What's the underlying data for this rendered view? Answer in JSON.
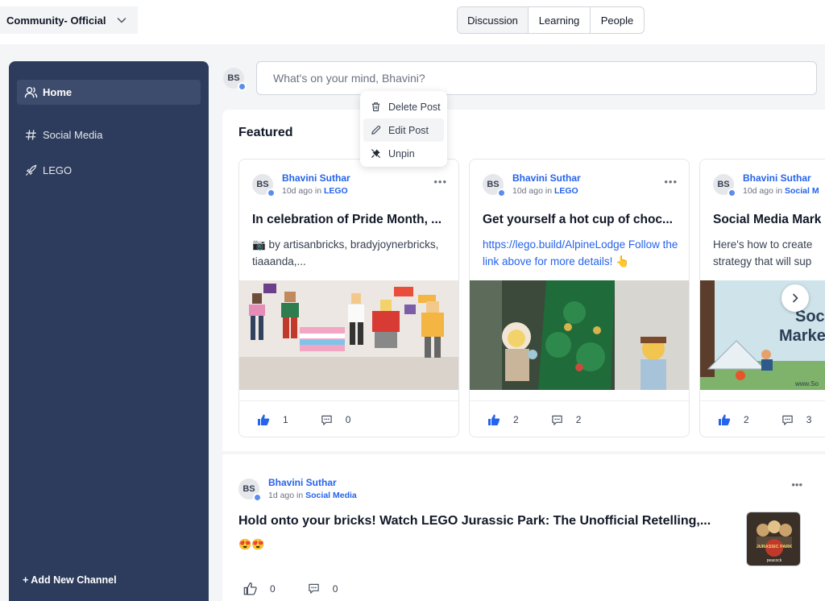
{
  "header": {
    "community": "Community- Official",
    "tabs": [
      "Discussion",
      "Learning",
      "People"
    ],
    "active_tab": "Discussion"
  },
  "sidebar": {
    "items": [
      {
        "label": "Home",
        "icon": "user-icon",
        "active": true
      },
      {
        "label": "Social Media",
        "icon": "hash-icon",
        "active": false
      },
      {
        "label": "LEGO",
        "icon": "rocket-icon",
        "active": false
      }
    ],
    "add_channel": "+ Add New Channel"
  },
  "composer": {
    "avatar": "BS",
    "placeholder": "What's on your mind, Bhavini?"
  },
  "menu": {
    "items": [
      {
        "label": "Delete Post",
        "icon": "trash-icon"
      },
      {
        "label": "Edit Post",
        "icon": "pencil-icon"
      },
      {
        "label": "Unpin",
        "icon": "unpin-icon"
      }
    ]
  },
  "featured": {
    "title": "Featured",
    "cards": [
      {
        "avatar": "BS",
        "author": "Bhavini Suthar",
        "time": "10d ago in",
        "channel": "LEGO",
        "title": "In celebration of Pride Month, ...",
        "body": "📷 by artisanbricks, bradyjoynerbricks, tiaaanda,...",
        "likes": "1",
        "comments": "0"
      },
      {
        "avatar": "BS",
        "author": "Bhavini Suthar",
        "time": "10d ago in",
        "channel": "LEGO",
        "title": "Get yourself a hot cup of choc...",
        "body": "https://lego.build/AlpineLodge Follow the link above for more details! 👆",
        "likes": "2",
        "comments": "2"
      },
      {
        "avatar": "BS",
        "author": "Bhavini Suthar",
        "time": "10d ago in",
        "channel": "Social M",
        "title": "Social Media Mark",
        "body": "Here's how to create strategy that will sup",
        "image_text_1": "Soc",
        "image_text_2": "Marke",
        "image_text_3": "www.So",
        "likes": "2",
        "comments": "3"
      }
    ]
  },
  "post": {
    "avatar": "BS",
    "author": "Bhavini Suthar",
    "time": "1d ago in",
    "channel": "Social Media",
    "title": "Hold onto your bricks! Watch LEGO Jurassic Park: The Unofficial Retelling,...",
    "emoji": "😍😍",
    "thumb_caption": "JURASSIC PARK",
    "thumb_brand": "peacock",
    "likes": "0",
    "comments": "0"
  },
  "colors": {
    "sidebar_bg": "#2d3c5c",
    "accent": "#2563eb"
  }
}
